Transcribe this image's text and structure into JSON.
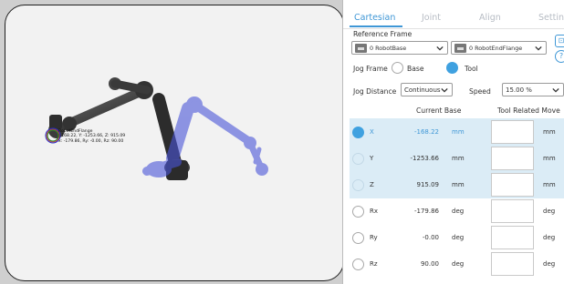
{
  "viewport": {
    "tag_name": "RobotEndFlange",
    "tag_line1": ":-168.22, Y: -1253.66, Z: 915.09",
    "tag_line2": "x: -179.86, Ry: -0.00, Rz: 90.00"
  },
  "tabs": [
    {
      "label": "Cartesian",
      "active": true
    },
    {
      "label": "Joint",
      "active": false
    },
    {
      "label": "Align",
      "active": false
    },
    {
      "label": "Settings",
      "active": false
    }
  ],
  "reference_frame": {
    "label": "Reference Frame",
    "base_select": "0 RobotBase",
    "flange_select": "0 RobotEndFlange"
  },
  "jog_frame": {
    "label": "Jog Frame",
    "options": [
      {
        "label": "Base",
        "selected": false
      },
      {
        "label": "Tool",
        "selected": true
      }
    ]
  },
  "jog_distance": {
    "label": "Jog Distance",
    "value": "Continuous",
    "speed_label": "Speed",
    "speed_value": "15.00 %"
  },
  "side_icons": {
    "top": "⊡",
    "help": "?"
  },
  "table": {
    "header_current": "Current Base",
    "header_tool": "Tool Related Move",
    "rows": [
      {
        "axis": "X",
        "value": "-168.22",
        "unit": "mm",
        "move_unit": "mm",
        "selected": true
      },
      {
        "axis": "Y",
        "value": "-1253.66",
        "unit": "mm",
        "move_unit": "mm",
        "selected": false
      },
      {
        "axis": "Z",
        "value": "915.09",
        "unit": "mm",
        "move_unit": "mm",
        "selected": false
      },
      {
        "axis": "Rx",
        "value": "-179.86",
        "unit": "deg",
        "move_unit": "deg",
        "selected": false
      },
      {
        "axis": "Ry",
        "value": "-0.00",
        "unit": "deg",
        "move_unit": "deg",
        "selected": false
      },
      {
        "axis": "Rz",
        "value": "90.00",
        "unit": "deg",
        "move_unit": "deg",
        "selected": false
      }
    ]
  },
  "colors": {
    "accent": "#3f97d6",
    "highlight": "#dbecf6",
    "ghost_robot": "#4a55d8"
  }
}
